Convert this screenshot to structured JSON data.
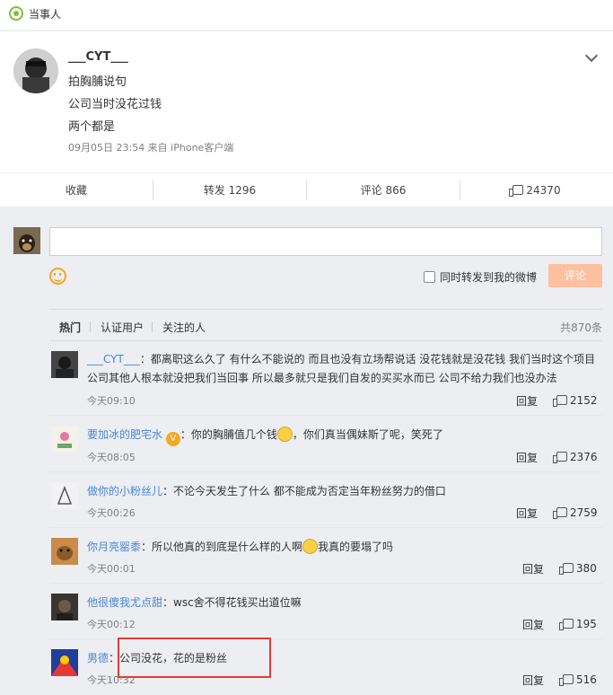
{
  "header": {
    "badge_label": "当事人"
  },
  "post": {
    "author": "___CYT___",
    "lines": [
      "拍胸脯说句",
      "公司当时没花过钱",
      "两个都是"
    ],
    "meta": "09月05日 23:54  来自 iPhone客户端"
  },
  "actions": {
    "favorite": "收藏",
    "repost": "转发 1296",
    "comment": "评论 866",
    "like_count": "24370"
  },
  "composer": {
    "also_repost_label": "同时转发到我的微博",
    "submit_label": "评论"
  },
  "filters": {
    "tabs": [
      "热门",
      "认证用户",
      "关注的人"
    ],
    "total": "共870条"
  },
  "comments": [
    {
      "user": "___CYT___",
      "text": "：都离职这么久了 有什么不能说的 而且也没有立场帮说话 没花钱就是没花钱 我们当时这个项目 公司其他人根本就没把我们当回事 所以最多就只是我们自发的买买水而已 公司不给力我们也没办法",
      "time": "今天09:10",
      "reply": "回复",
      "likes": "2152"
    },
    {
      "user": "要加冰的肥宅水",
      "text": "：你的胸脯值几个钱",
      "text2": "，你们真当偶妹斯了呢，笑死了",
      "time": "今天08:05",
      "reply": "回复",
      "likes": "2376"
    },
    {
      "user": "做你的小粉丝儿",
      "text": "：不论今天发生了什么 都不能成为否定当年粉丝努力的借口",
      "time": "今天00:26",
      "reply": "回复",
      "likes": "2759"
    },
    {
      "user": "你月亮罂黍",
      "text": "：所以他真的到底是什么样的人啊",
      "text2": "我真的要塌了吗",
      "time": "今天00:01",
      "reply": "回复",
      "likes": "380"
    },
    {
      "user": "他很傻我尤点甜",
      "text": "：wsc舍不得花钱买出道位嘛",
      "time": "今天00:12",
      "reply": "回复",
      "likes": "195"
    },
    {
      "user": "男德",
      "text": "：公司没花，花的是粉丝",
      "time": "今天10:32",
      "reply": "回复",
      "likes": "516"
    }
  ]
}
